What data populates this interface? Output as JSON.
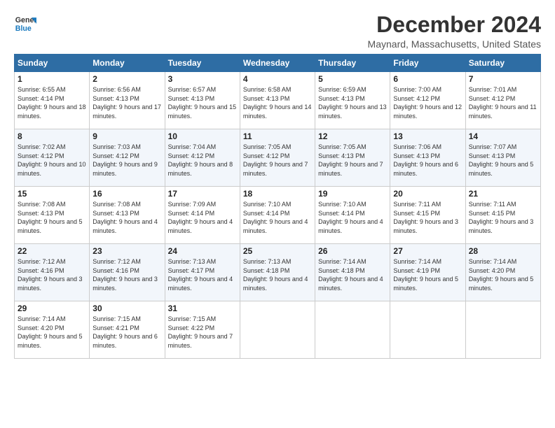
{
  "logo": {
    "line1": "General",
    "line2": "Blue"
  },
  "title": "December 2024",
  "location": "Maynard, Massachusetts, United States",
  "headers": [
    "Sunday",
    "Monday",
    "Tuesday",
    "Wednesday",
    "Thursday",
    "Friday",
    "Saturday"
  ],
  "weeks": [
    [
      {
        "day": "1",
        "sunrise": "6:55 AM",
        "sunset": "4:14 PM",
        "daylight": "9 hours and 18 minutes."
      },
      {
        "day": "2",
        "sunrise": "6:56 AM",
        "sunset": "4:13 PM",
        "daylight": "9 hours and 17 minutes."
      },
      {
        "day": "3",
        "sunrise": "6:57 AM",
        "sunset": "4:13 PM",
        "daylight": "9 hours and 15 minutes."
      },
      {
        "day": "4",
        "sunrise": "6:58 AM",
        "sunset": "4:13 PM",
        "daylight": "9 hours and 14 minutes."
      },
      {
        "day": "5",
        "sunrise": "6:59 AM",
        "sunset": "4:13 PM",
        "daylight": "9 hours and 13 minutes."
      },
      {
        "day": "6",
        "sunrise": "7:00 AM",
        "sunset": "4:12 PM",
        "daylight": "9 hours and 12 minutes."
      },
      {
        "day": "7",
        "sunrise": "7:01 AM",
        "sunset": "4:12 PM",
        "daylight": "9 hours and 11 minutes."
      }
    ],
    [
      {
        "day": "8",
        "sunrise": "7:02 AM",
        "sunset": "4:12 PM",
        "daylight": "9 hours and 10 minutes."
      },
      {
        "day": "9",
        "sunrise": "7:03 AM",
        "sunset": "4:12 PM",
        "daylight": "9 hours and 9 minutes."
      },
      {
        "day": "10",
        "sunrise": "7:04 AM",
        "sunset": "4:12 PM",
        "daylight": "9 hours and 8 minutes."
      },
      {
        "day": "11",
        "sunrise": "7:05 AM",
        "sunset": "4:12 PM",
        "daylight": "9 hours and 7 minutes."
      },
      {
        "day": "12",
        "sunrise": "7:05 AM",
        "sunset": "4:13 PM",
        "daylight": "9 hours and 7 minutes."
      },
      {
        "day": "13",
        "sunrise": "7:06 AM",
        "sunset": "4:13 PM",
        "daylight": "9 hours and 6 minutes."
      },
      {
        "day": "14",
        "sunrise": "7:07 AM",
        "sunset": "4:13 PM",
        "daylight": "9 hours and 5 minutes."
      }
    ],
    [
      {
        "day": "15",
        "sunrise": "7:08 AM",
        "sunset": "4:13 PM",
        "daylight": "9 hours and 5 minutes."
      },
      {
        "day": "16",
        "sunrise": "7:08 AM",
        "sunset": "4:13 PM",
        "daylight": "9 hours and 4 minutes."
      },
      {
        "day": "17",
        "sunrise": "7:09 AM",
        "sunset": "4:14 PM",
        "daylight": "9 hours and 4 minutes."
      },
      {
        "day": "18",
        "sunrise": "7:10 AM",
        "sunset": "4:14 PM",
        "daylight": "9 hours and 4 minutes."
      },
      {
        "day": "19",
        "sunrise": "7:10 AM",
        "sunset": "4:14 PM",
        "daylight": "9 hours and 4 minutes."
      },
      {
        "day": "20",
        "sunrise": "7:11 AM",
        "sunset": "4:15 PM",
        "daylight": "9 hours and 3 minutes."
      },
      {
        "day": "21",
        "sunrise": "7:11 AM",
        "sunset": "4:15 PM",
        "daylight": "9 hours and 3 minutes."
      }
    ],
    [
      {
        "day": "22",
        "sunrise": "7:12 AM",
        "sunset": "4:16 PM",
        "daylight": "9 hours and 3 minutes."
      },
      {
        "day": "23",
        "sunrise": "7:12 AM",
        "sunset": "4:16 PM",
        "daylight": "9 hours and 3 minutes."
      },
      {
        "day": "24",
        "sunrise": "7:13 AM",
        "sunset": "4:17 PM",
        "daylight": "9 hours and 4 minutes."
      },
      {
        "day": "25",
        "sunrise": "7:13 AM",
        "sunset": "4:18 PM",
        "daylight": "9 hours and 4 minutes."
      },
      {
        "day": "26",
        "sunrise": "7:14 AM",
        "sunset": "4:18 PM",
        "daylight": "9 hours and 4 minutes."
      },
      {
        "day": "27",
        "sunrise": "7:14 AM",
        "sunset": "4:19 PM",
        "daylight": "9 hours and 5 minutes."
      },
      {
        "day": "28",
        "sunrise": "7:14 AM",
        "sunset": "4:20 PM",
        "daylight": "9 hours and 5 minutes."
      }
    ],
    [
      {
        "day": "29",
        "sunrise": "7:14 AM",
        "sunset": "4:20 PM",
        "daylight": "9 hours and 5 minutes."
      },
      {
        "day": "30",
        "sunrise": "7:15 AM",
        "sunset": "4:21 PM",
        "daylight": "9 hours and 6 minutes."
      },
      {
        "day": "31",
        "sunrise": "7:15 AM",
        "sunset": "4:22 PM",
        "daylight": "9 hours and 7 minutes."
      },
      null,
      null,
      null,
      null
    ]
  ]
}
